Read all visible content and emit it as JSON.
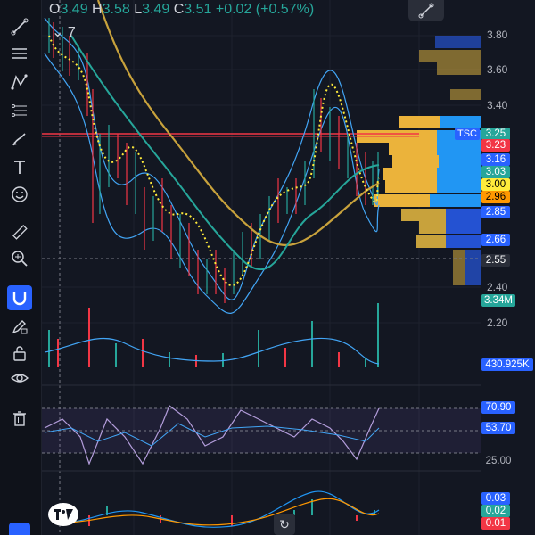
{
  "ohlc": {
    "open_label": "O",
    "open": "3.49",
    "high_label": "H",
    "high": "3.58",
    "low_label": "L",
    "low": "3.49",
    "close_label": "C",
    "close": "3.51",
    "change": "+0.02 (+0.57%)"
  },
  "collapsed_count": "7",
  "symbol": "TSC",
  "price_axis_ticks": [
    "3.80",
    "3.60",
    "3.40",
    "2.40",
    "2.20"
  ],
  "price_labels": [
    {
      "text": "3.25",
      "bg": "#26a69a",
      "fg": "#ffffff"
    },
    {
      "text": "3.23",
      "bg": "#f23645",
      "fg": "#ffffff"
    },
    {
      "text": "3.16",
      "bg": "#2962ff",
      "fg": "#ffffff"
    },
    {
      "text": "3.03",
      "bg": "#26a69a",
      "fg": "#ffffff"
    },
    {
      "text": "3.00",
      "bg": "#ffeb3b",
      "fg": "#000000"
    },
    {
      "text": "2.96",
      "bg": "#ff9800",
      "fg": "#000000"
    },
    {
      "text": "2.85",
      "bg": "#2962ff",
      "fg": "#ffffff"
    },
    {
      "text": "2.66",
      "bg": "#2962ff",
      "fg": "#ffffff"
    },
    {
      "text": "2.55",
      "bg": "#2a2e39",
      "fg": "#ffffff"
    },
    {
      "text": "3.34M",
      "bg": "#26a69a",
      "fg": "#ffffff"
    },
    {
      "text": "430.925K",
      "bg": "#2962ff",
      "fg": "#ffffff"
    },
    {
      "text": "70.90",
      "bg": "#2962ff",
      "fg": "#ffffff"
    },
    {
      "text": "53.70",
      "bg": "#2962ff",
      "fg": "#ffffff"
    },
    {
      "text": "25.00",
      "bg": "#131722",
      "fg": "#b2b5be"
    },
    {
      "text": "0.03",
      "bg": "#2962ff",
      "fg": "#ffffff"
    },
    {
      "text": "0.02",
      "bg": "#26a69a",
      "fg": "#ffffff"
    },
    {
      "text": "0.01",
      "bg": "#f23645",
      "fg": "#ffffff"
    }
  ],
  "colors": {
    "background": "#131722",
    "accent": "#2962ff",
    "up": "#26a69a",
    "down": "#f23645"
  },
  "tools": [
    "trend-line-icon",
    "horizontal-lines-icon",
    "pattern-icon",
    "fib-icon",
    "brush-icon",
    "text-icon",
    "emoji-icon",
    "ruler-icon",
    "zoom-icon",
    "magnet-icon",
    "lock-pen-icon",
    "lock-icon",
    "eye-icon",
    "trash-icon"
  ]
}
